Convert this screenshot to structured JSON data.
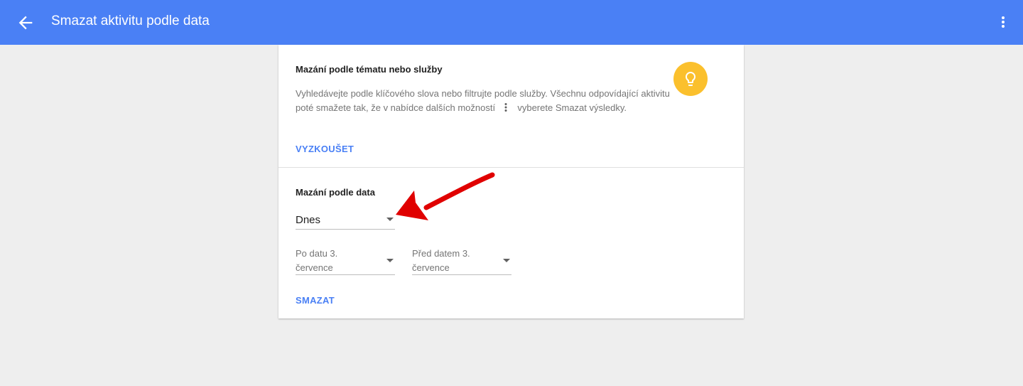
{
  "appbar": {
    "title": "Smazat aktivitu podle data",
    "back_icon": "arrow-back-icon",
    "menu_icon": "more-vert-icon",
    "color": "#4a80f5"
  },
  "topic_section": {
    "title": "Mazání podle tématu nebo služby",
    "description_before": "Vyhledávejte podle klíčového slova nebo filtrujte podle služby. Všechnu odpovídající aktivitu poté smažete tak, že v nabídce dalších možností",
    "description_after": "vyberete Smazat výsledky.",
    "inline_icon": "more-vert-icon",
    "tip_icon": "lightbulb-icon",
    "tip_color": "#fbc02d",
    "try_label": "VYZKOUŠET"
  },
  "date_section": {
    "title": "Mazání podle data",
    "range_select": {
      "value": "Dnes"
    },
    "after_select": {
      "value": "Po datu 3. července"
    },
    "before_select": {
      "value": "Před datem 3. července"
    },
    "delete_label": "SMAZAT"
  },
  "annotation": {
    "icon": "red-arrow-annotation",
    "color": "#e00000"
  }
}
